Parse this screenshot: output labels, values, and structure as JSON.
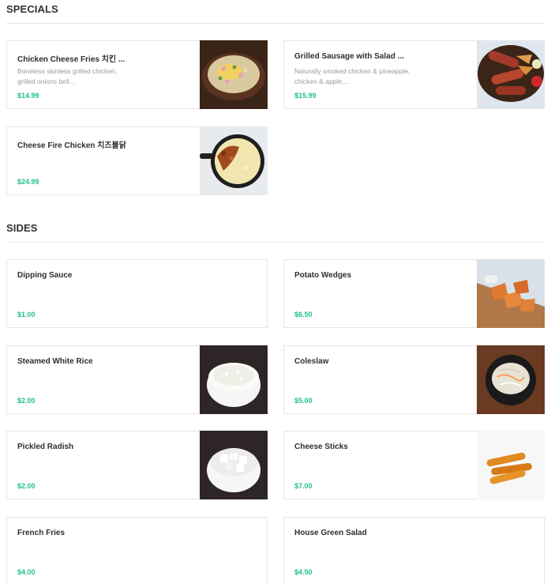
{
  "specials": {
    "title": "SPECIALS",
    "items": [
      {
        "name": "Chicken Cheese Fries 치킨 ...",
        "description": "Boneless skinless grilled chicken, grilled onions bell...",
        "price": "$14.99"
      },
      {
        "name": "Grilled Sausage with Salad ...",
        "description": "Naturally smoked chicken & pineapple, chicken & apple,...",
        "price": "$15.99"
      },
      {
        "name": "Cheese Fire Chicken 치즈불닭",
        "description": "",
        "price": "$24.99"
      }
    ]
  },
  "sides": {
    "title": "SIDES",
    "items": [
      {
        "name": "Dipping Sauce",
        "price": "$1.00"
      },
      {
        "name": "Potato Wedges",
        "price": "$6.50"
      },
      {
        "name": "Steamed White Rice",
        "price": "$2.00"
      },
      {
        "name": "Coleslaw",
        "price": "$5.00"
      },
      {
        "name": "Pickled Radish",
        "price": "$2.00"
      },
      {
        "name": "Cheese Sticks",
        "price": "$7.00"
      },
      {
        "name": "French Fries",
        "price": "$4.00"
      },
      {
        "name": "House Green Salad",
        "price": "$4.50"
      }
    ]
  },
  "colors": {
    "price": "#1fbf8f",
    "border": "#e6e6e6",
    "heading": "#333333"
  }
}
